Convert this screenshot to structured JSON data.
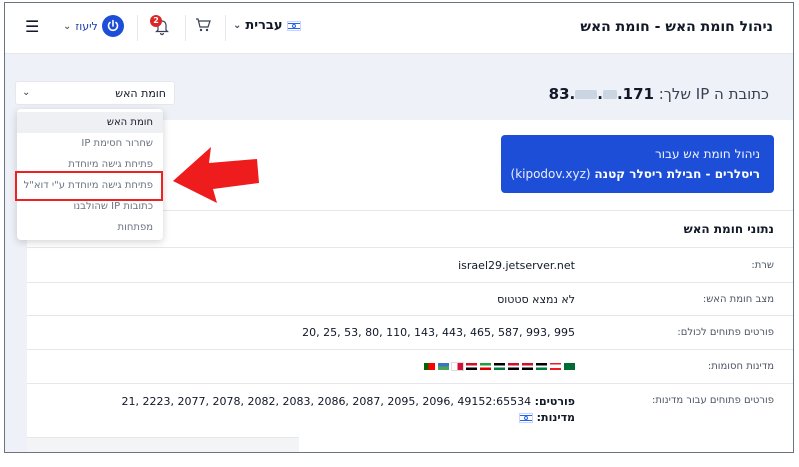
{
  "header": {
    "title": "ניהול חומת האש - חומת האש",
    "language": "עברית",
    "notifications_count": "2",
    "user_label": "ליעוז"
  },
  "ip": {
    "label": "כתובת ה IP שלך:",
    "octet1": "83.",
    "dot": ".",
    "octet4": ".171"
  },
  "section_select": {
    "value": "חומת האש"
  },
  "dropdown": {
    "items": [
      "חומת האש",
      "שחרור חסימת IP",
      "פתיחת גישה מיוחדת",
      "פתיחת גישה מיוחדת ע\"י דוא\"ל",
      "כתובות IP שהולבנו",
      "מפתחות"
    ]
  },
  "info_box": {
    "line1": "ניהול חומת אש עבור",
    "plan": "ריסלרים - חבילת ריסלר קטנה",
    "domain": "(kipodov.xyz)"
  },
  "firewall": {
    "section_title": "נתוני חומת האש",
    "rows": [
      {
        "label": "שרת:",
        "value": "israel29.jetserver.net"
      },
      {
        "label": "מצב חומת האש:",
        "value": "לא נמצא סטטוס"
      },
      {
        "label": "פורטים פתוחים לכולם:",
        "value": "20, 25, 53, 80, 110, 143, 443, 465, 587, 993, 995"
      },
      {
        "label": "מדינות חסומות:",
        "value": ""
      },
      {
        "label": "פורטים פתוחים עבור מדינות:",
        "ports_label": "פורטים:",
        "ports_value": "21, 2223, 2077, 2078, 2082, 2083, 2086, 2087, 2095, 2096, 49152:65534",
        "countries_label": "מדינות:"
      }
    ]
  },
  "colors": {
    "primary": "#1d4ed8",
    "highlight": "#ef2020",
    "badge": "#dc2626"
  }
}
